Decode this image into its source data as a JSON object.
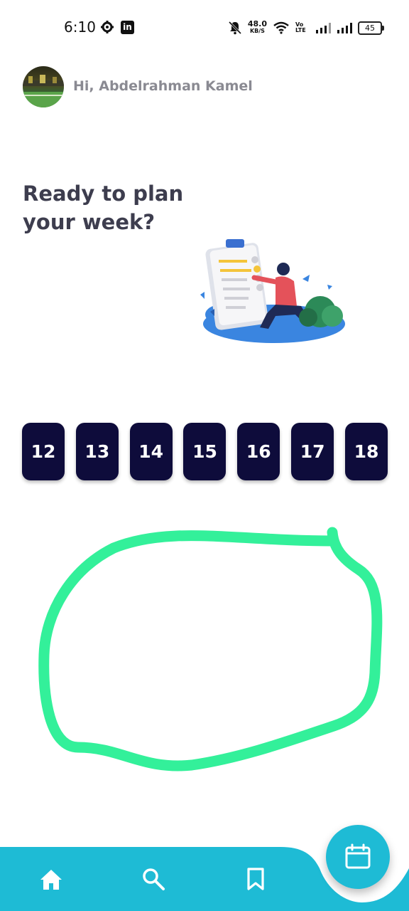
{
  "status_bar": {
    "time": "6:10",
    "net_speed": "48.0",
    "net_unit": "KB/S",
    "volte": "Vo LTE",
    "battery": "45"
  },
  "header": {
    "greeting": "Hi, Abdelrahman Kamel"
  },
  "main": {
    "headline_line1": "Ready to plan",
    "headline_line2": "your week?",
    "dates": [
      "12",
      "13",
      "14",
      "15",
      "16",
      "17",
      "18"
    ]
  },
  "bottom_nav": {
    "items": [
      {
        "icon": "home-icon"
      },
      {
        "icon": "search-icon"
      },
      {
        "icon": "bookmark-icon"
      }
    ],
    "fab_icon": "calendar-icon"
  },
  "colors": {
    "accent": "#1ebbd5",
    "chip_bg": "#0e0c3b",
    "annotation": "#33f09a",
    "headline": "#3d3d4e"
  }
}
